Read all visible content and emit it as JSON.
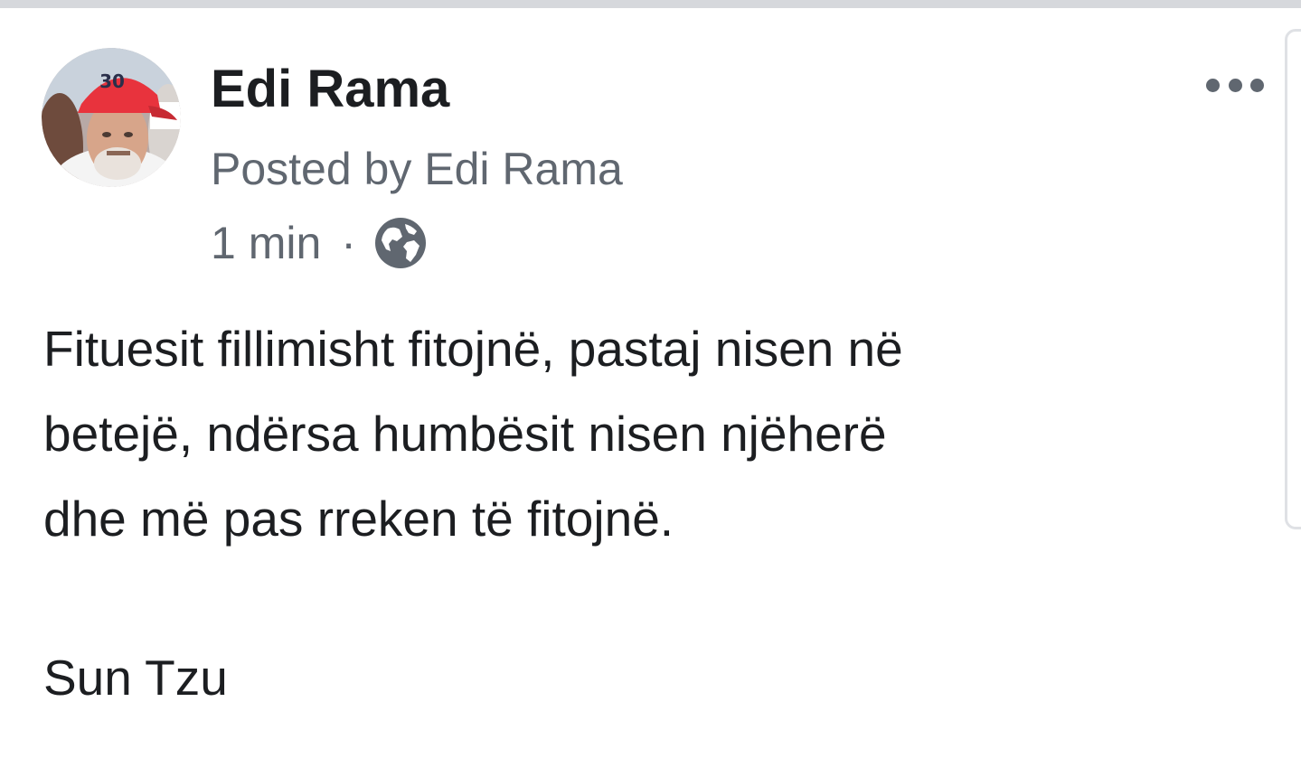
{
  "post": {
    "author_name": "Edi Rama",
    "posted_by": "Posted by Edi Rama",
    "time": "1 min",
    "separator": "·",
    "privacy_icon": "globe-icon",
    "menu_icon": "more-options-icon",
    "text_lines": [
      "Fituesit fillimisht fitojnë, pastaj nisen në",
      "betejë, ndërsa humbësit nisen njëherë",
      "dhe më pas rreken të fitojnë."
    ],
    "signature": "Sun Tzu",
    "avatar": {
      "cap_number": "30",
      "cap_color": "#e8333d"
    }
  },
  "colors": {
    "primary_text": "#1c1e21",
    "secondary_text": "#606770",
    "top_bar": "#d6d8dc"
  }
}
